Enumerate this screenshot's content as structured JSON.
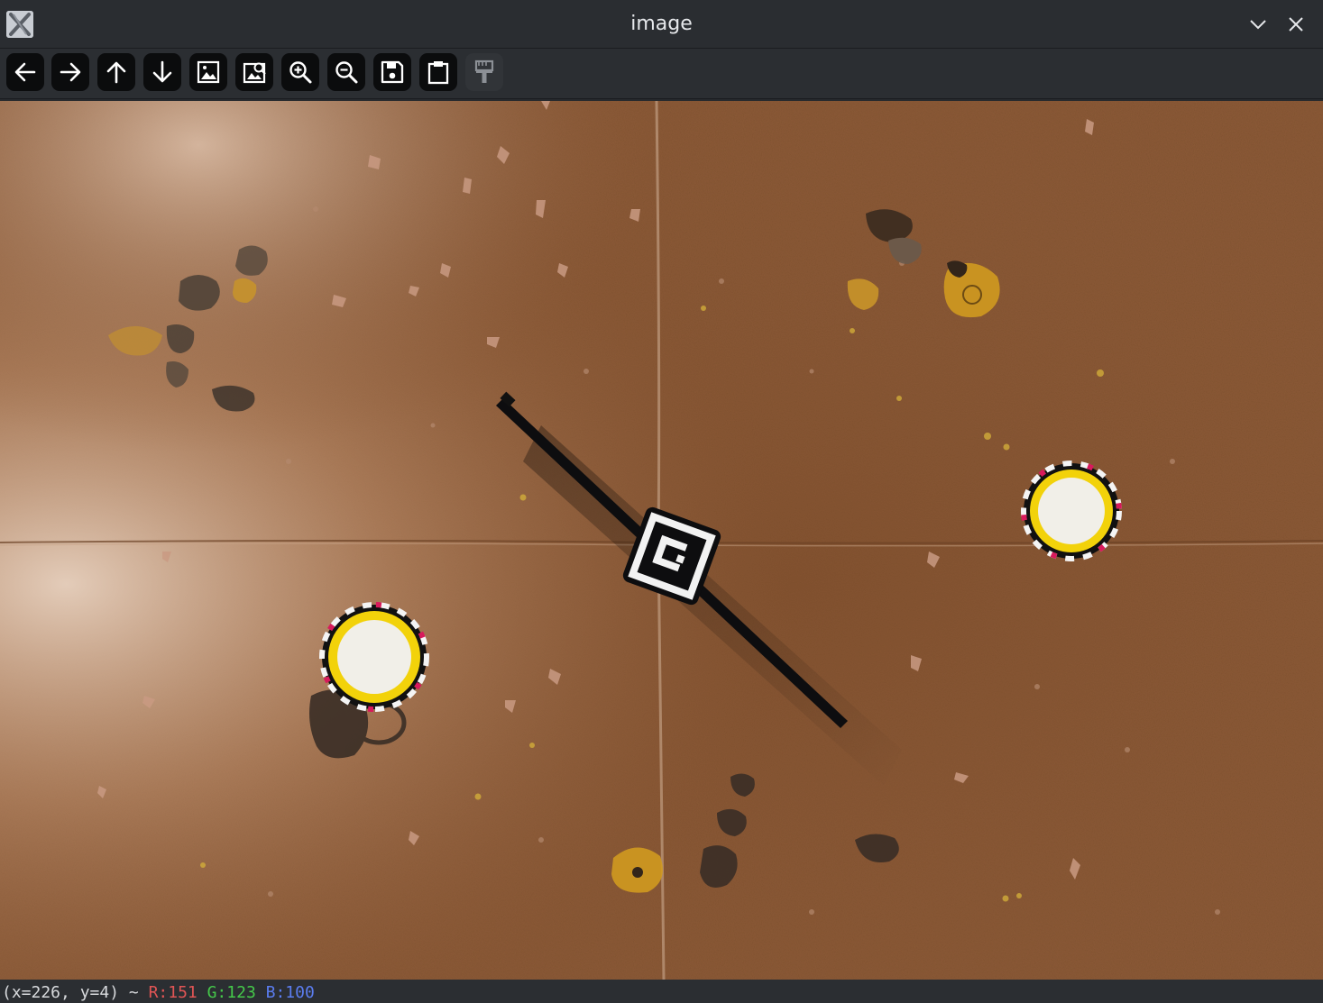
{
  "window": {
    "title": "image"
  },
  "toolbar": {
    "buttons": [
      {
        "name": "back-button",
        "icon": "arrow-left-icon"
      },
      {
        "name": "forward-button",
        "icon": "arrow-right-icon"
      },
      {
        "name": "up-button",
        "icon": "arrow-up-icon"
      },
      {
        "name": "down-button",
        "icon": "arrow-down-icon"
      },
      {
        "name": "fit-image-button",
        "icon": "image-icon"
      },
      {
        "name": "zoom-original-button",
        "icon": "image-zoom-icon"
      },
      {
        "name": "zoom-in-button",
        "icon": "zoom-in-icon"
      },
      {
        "name": "zoom-out-button",
        "icon": "zoom-out-icon"
      },
      {
        "name": "save-button",
        "icon": "floppy-disk-icon"
      },
      {
        "name": "copy-to-clipboard-button",
        "icon": "clipboard-icon"
      },
      {
        "name": "properties-button",
        "icon": "paint-brush-icon",
        "disabled": true
      }
    ]
  },
  "status": {
    "coords": "(x=226, y=4) ~",
    "r": "R:151",
    "g": "G:123",
    "b": "B:100"
  },
  "colors": {
    "mat_base": "#8c5a36",
    "mat_highlight": "#d4b49a",
    "status_r": "#e05555",
    "status_g": "#45c84a",
    "status_b": "#5b7df0",
    "objective_yellow": "#f2d20a"
  }
}
